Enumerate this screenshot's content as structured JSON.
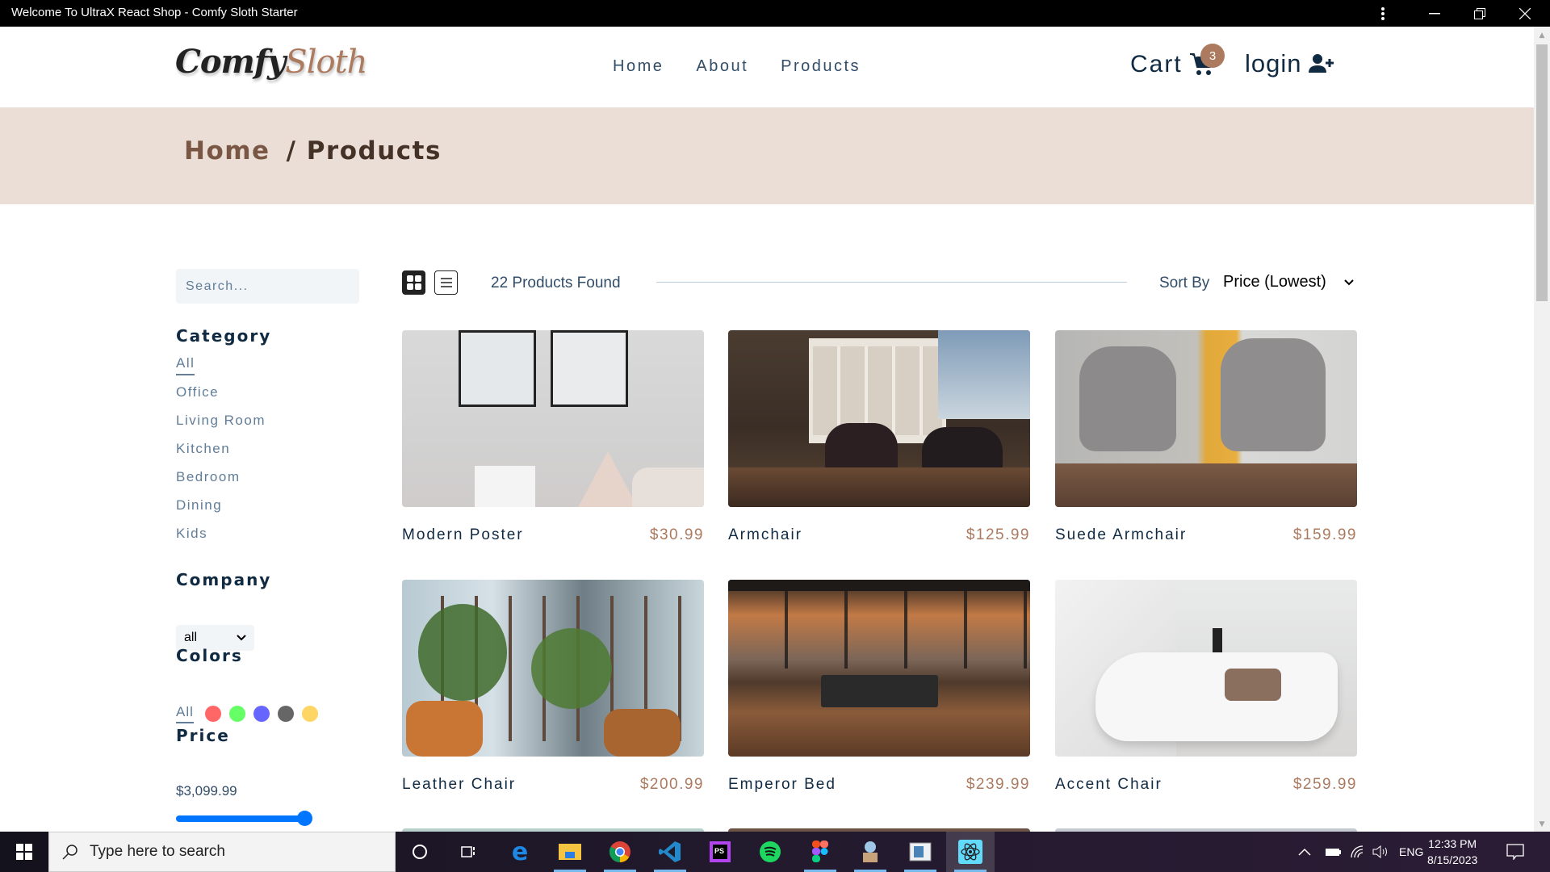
{
  "window": {
    "title": "Welcome To UltraX React Shop - Comfy Sloth Starter",
    "controls": [
      "menu",
      "minimize",
      "restore",
      "close"
    ]
  },
  "nav": {
    "logo_part1": "Comfy",
    "logo_part2": "Sloth",
    "links": [
      {
        "label": "Home"
      },
      {
        "label": "About"
      },
      {
        "label": "Products"
      }
    ],
    "cart_label": "Cart",
    "cart_count": "3",
    "login_label": "login"
  },
  "hero": {
    "breadcrumb_home": "Home",
    "breadcrumb_current": "/ Products"
  },
  "filters": {
    "search_placeholder": "Search...",
    "category_heading": "Category",
    "categories": [
      "All",
      "Office",
      "Living Room",
      "Kitchen",
      "Bedroom",
      "Dining",
      "Kids"
    ],
    "active_category": "All",
    "company_heading": "Company",
    "company_selected": "all",
    "colors_heading": "Colors",
    "colors_all_label": "All",
    "colors": [
      "#ff0000",
      "#00ff00",
      "#0000ff",
      "#000000",
      "#ffb900"
    ],
    "price_heading": "Price",
    "price_value": "$3,099.99",
    "price_slider_fraction": 1.0
  },
  "toolbar": {
    "count_text": "22 Products Found",
    "sort_label": "Sort By",
    "sort_selected": "Price (Lowest)",
    "active_view": "grid"
  },
  "products": [
    {
      "name": "Modern Poster",
      "price": "$30.99"
    },
    {
      "name": "Armchair",
      "price": "$125.99"
    },
    {
      "name": "Suede Armchair",
      "price": "$159.99"
    },
    {
      "name": "Leather Chair",
      "price": "$200.99"
    },
    {
      "name": "Emperor Bed",
      "price": "$239.99"
    },
    {
      "name": "Accent Chair",
      "price": "$259.99"
    }
  ],
  "taskbar": {
    "search_placeholder": "Type here to search",
    "apps": [
      "cortana",
      "task-view",
      "edge",
      "file-explorer",
      "chrome",
      "vscode",
      "phpstorm",
      "spotify",
      "figma",
      "app-character",
      "app-window",
      "react-app"
    ],
    "language": "ENG",
    "time": "12:33 PM",
    "date": "8/15/2023"
  }
}
